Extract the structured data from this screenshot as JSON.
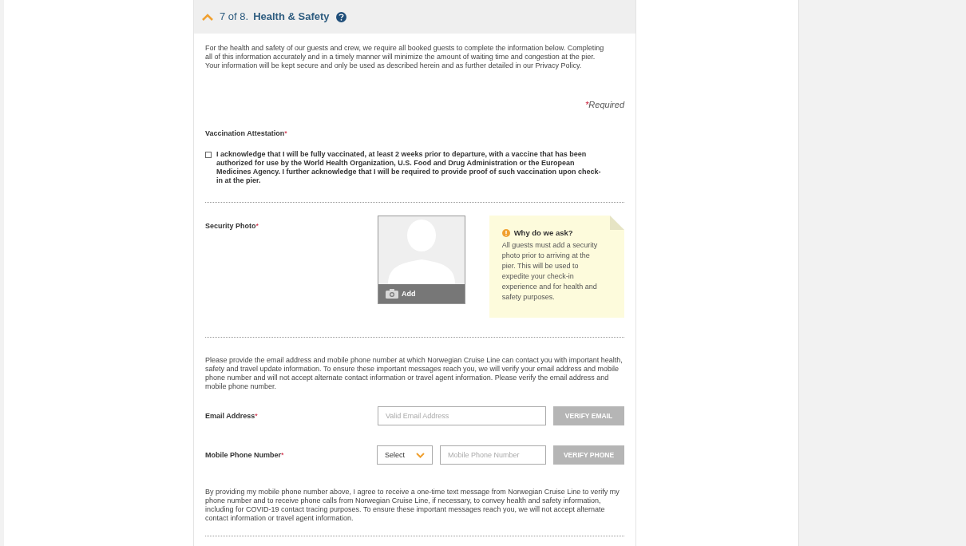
{
  "section": {
    "step": "7 of 8.",
    "title": "Health & Safety",
    "expanded": true
  },
  "intro": "For the health and safety of our guests and crew, we require all booked guests to complete the information below. Completing all of this information accurately and in a timely manner will minimize the amount of waiting time and congestion at the pier. Your information will be kept secure and only be used as described herein and as further detailed in our Privacy Policy.",
  "required_note": {
    "asterisk": "*",
    "text": "Required"
  },
  "vaccination": {
    "label": "Vaccination Attestation",
    "asterisk": "*",
    "checked": false,
    "text": "I acknowledge that I will be fully vaccinated, at least 2 weeks prior to departure, with a vaccine that has been authorized for use by the World Health Organization, U.S. Food and Drug Administration or the European Medicines Agency. I further acknowledge that I will be required to provide proof of such vaccination upon check-in at the pier."
  },
  "security_photo": {
    "label": "Security Photo",
    "asterisk": "*",
    "add": "Add",
    "note": {
      "title": "Why do we ask?",
      "text": "All guests must add a security photo prior to arriving at the pier. This will be used to expedite your check-in experience and for health and safety purposes."
    }
  },
  "contact_intro": "Please provide the email address and mobile phone number at which Norwegian Cruise Line can contact you with important health, safety and travel update information. To ensure these important messages reach you, we will verify your email address and mobile phone number and will not accept alternate contact information or travel agent information. Please verify the email address and mobile phone number.",
  "fields": [
    {
      "kind": "email",
      "label": "Email Address",
      "asterisk": "*",
      "placeholder": "Valid Email Address",
      "button": "VERIFY EMAIL"
    },
    {
      "kind": "phone",
      "label": "Mobile Phone Number",
      "asterisk": "*",
      "select": "Select",
      "placeholder": "Mobile Phone Number",
      "button": "VERIFY PHONE"
    }
  ],
  "consent": "By providing my mobile phone number above, I agree to receive a one-time text message from Norwegian Cruise Line to verify my phone number and to receive phone calls from Norwegian Cruise Line, if necessary, to convey health and safety information, including for COVID-19 contact tracing purposes. To ensure these important messages reach you, we will not accept alternate contact information or travel agent information."
}
